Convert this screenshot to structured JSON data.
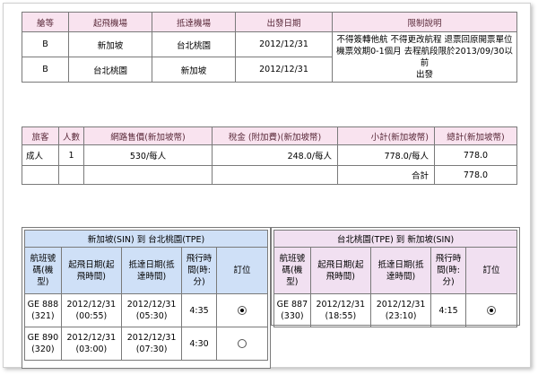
{
  "restrictions": {
    "headers": [
      "艙等",
      "起飛機場",
      "抵達機場",
      "出發日期",
      "限制說明"
    ],
    "rows": [
      {
        "cabin": "B",
        "from": "新加坡",
        "to": "台北桃園",
        "date": "2012/12/31"
      },
      {
        "cabin": "B",
        "from": "台北桃園",
        "to": "新加坡",
        "date": "2012/12/31"
      }
    ],
    "note": "不得簽轉他航 不得更改航程 退票回原開票單位\n機票效期0-1個月 去程航段限於2013/09/30以前\n出發"
  },
  "pricing": {
    "headers": [
      "旅客",
      "人數",
      "網路售價(新加坡幣)",
      "稅金 (附加費)(新加坡幣)",
      "小計(新加坡幣)",
      "總計(新加坡幣)"
    ],
    "row": {
      "type": "成人",
      "count": "1",
      "fare": "530/每人",
      "tax": "248.0/每人",
      "subtotal": "778.0/每人",
      "total": "778.0"
    },
    "sum_label": "合計",
    "sum_value": "778.0"
  },
  "outbound": {
    "title": "新加坡(SIN) 到 台北桃園(TPE)",
    "col_flight": "航班號\n碼(機\n型)",
    "col_depart": "起飛日期(起\n飛時間)",
    "col_arrive": "抵達日期(抵\n達時間)",
    "col_duration": "飛行時\n間(時:\n分)",
    "col_book": "訂位",
    "flights": [
      {
        "flight": "GE 888\n(321)",
        "depart": "2012/12/31\n(00:55)",
        "arrive": "2012/12/31\n(05:30)",
        "duration": "4:35",
        "selected": true
      },
      {
        "flight": "GE 890\n(320)",
        "depart": "2012/12/31\n(03:00)",
        "arrive": "2012/12/31\n(07:30)",
        "duration": "4:30",
        "selected": false
      }
    ]
  },
  "return": {
    "title": "台北桃園(TPE) 到 新加坡(SIN)",
    "col_flight": "航班號\n碼(機\n型)",
    "col_depart": "起飛日期(起\n飛時間)",
    "col_arrive": "抵達日期(抵\n達時間)",
    "col_duration": "飛行時\n間(時:\n分)",
    "col_book": "訂位",
    "flights": [
      {
        "flight": "GE 887\n(330)",
        "depart": "2012/12/31\n(18:55)",
        "arrive": "2012/12/31\n(23:10)",
        "duration": "4:15",
        "selected": true
      }
    ]
  }
}
